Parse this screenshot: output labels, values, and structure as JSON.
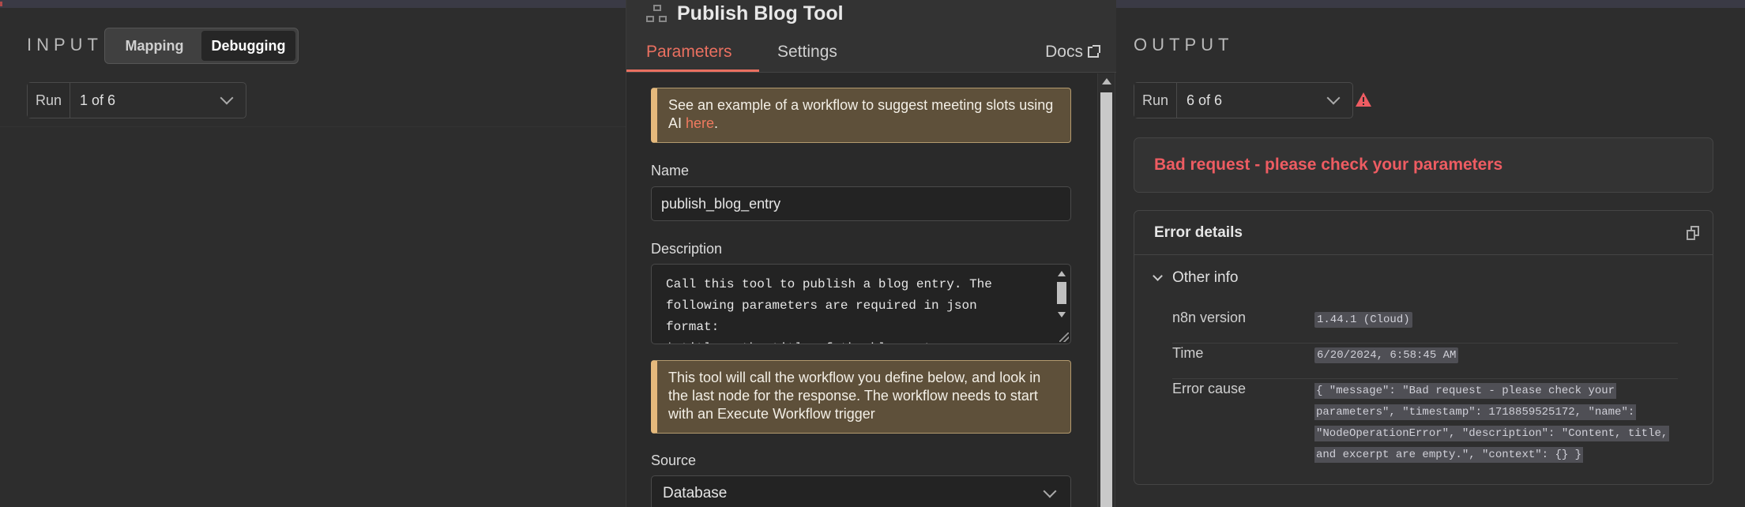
{
  "input_panel": {
    "label": "INPUT",
    "modes": {
      "mapping": "Mapping",
      "debugging": "Debugging"
    },
    "run_label": "Run",
    "run_value": "1 of 6"
  },
  "node": {
    "title": "Publish Blog Tool",
    "tabs": {
      "parameters": "Parameters",
      "settings": "Settings"
    },
    "docs_label": "Docs",
    "notice1": {
      "text": "See an example of a workflow to suggest meeting slots using AI ",
      "link": "here",
      "suffix": "."
    },
    "name_label": "Name",
    "name_value": "publish_blog_entry",
    "description_label": "Description",
    "description_lines": [
      "Call this tool to publish a blog entry. The",
      "following parameters are required in json",
      "format:",
      "* title - the title of the blog entry"
    ],
    "notice2": "This tool will call the workflow you define below, and look in the last node for the response. The workflow needs to start with an Execute Workflow trigger",
    "source_label": "Source",
    "source_value": "Database"
  },
  "output_panel": {
    "label": "OUTPUT",
    "run_label": "Run",
    "run_value": "6 of 6",
    "error_title": "Bad request - please check your parameters",
    "details_title": "Error details",
    "other_info_label": "Other info",
    "rows": [
      {
        "key": "n8n version",
        "value": "1.44.1 (Cloud)"
      },
      {
        "key": "Time",
        "value": "6/20/2024, 6:58:45 AM"
      },
      {
        "key": "Error cause",
        "value_lines": [
          "{ \"message\": \"Bad request - please check your",
          "parameters\", \"timestamp\": 1718859525172, \"name\":",
          "\"NodeOperationError\", \"description\": \"Content, title,",
          "and excerpt are empty.\", \"context\": {} }"
        ]
      }
    ]
  },
  "colors": {
    "accent": "#ea7060",
    "error": "#ee5c62",
    "notice_border": "#e5b97c"
  },
  "icons": [
    "node-tool-icon",
    "external-link-icon",
    "chevron-down-icon",
    "warning-icon",
    "copy-icon"
  ]
}
